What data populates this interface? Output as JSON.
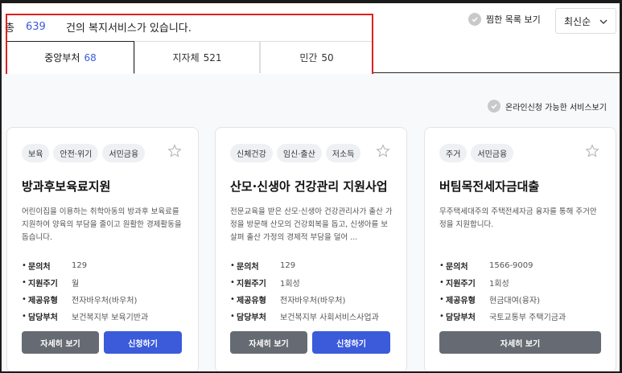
{
  "header": {
    "total_prefix": "총",
    "total_count": "639",
    "total_suffix": "건의 복지서비스가 있습니다.",
    "wishlist_label": "찜한 목록 보기",
    "sort_value": "최신순"
  },
  "tabs": [
    {
      "label": "중앙부처",
      "count": "68",
      "active": true
    },
    {
      "label": "지자체",
      "count": "521",
      "active": false
    },
    {
      "label": "민간",
      "count": "50",
      "active": false
    }
  ],
  "online_filter_label": "온라인신청 가능한 서비스보기",
  "cards": [
    {
      "tags": [
        "보육",
        "안전·위기",
        "서민금융"
      ],
      "title": "방과후보육료지원",
      "description": "어린이집을 이용하는 취학아동의 방과후 보육료를 지원하여 양육의 부담을 줄이고 원활한 경제활동을 돕습니다.",
      "info": [
        {
          "label": "문의처",
          "value": "129"
        },
        {
          "label": "지원주기",
          "value": "월"
        },
        {
          "label": "제공유형",
          "value": "전자바우처(바우처)"
        },
        {
          "label": "담당부처",
          "value": "보건복지부 보육기반과"
        }
      ],
      "detail_label": "자세히 보기",
      "apply_label": "신청하기"
    },
    {
      "tags": [
        "신체건강",
        "임신·출산",
        "저소득"
      ],
      "title": "산모·신생아 건강관리 지원사업",
      "description": "전문교육을 받은 산모·신생아 건강관리사가 출산 가정을 방문해 산모의 건강회복을 돕고, 신생아를 보살펴 출산 가정의 경제적 부담을 덜어 ...",
      "info": [
        {
          "label": "문의처",
          "value": "129"
        },
        {
          "label": "지원주기",
          "value": "1회성"
        },
        {
          "label": "제공유형",
          "value": "전자바우처(바우처)"
        },
        {
          "label": "담당부처",
          "value": "보건복지부 사회서비스사업과"
        }
      ],
      "detail_label": "자세히 보기",
      "apply_label": "신청하기"
    },
    {
      "tags": [
        "주거",
        "서민금융"
      ],
      "title": "버팀목전세자금대출",
      "description": "무주택세대주의 주택전세자금 융자를 통해 주거안정을 지원합니다.",
      "info": [
        {
          "label": "문의처",
          "value": "1566-9009"
        },
        {
          "label": "지원주기",
          "value": "1회성"
        },
        {
          "label": "제공유형",
          "value": "현금대여(융자)"
        },
        {
          "label": "담당부처",
          "value": "국토교통부 주택기금과"
        }
      ],
      "detail_label": "자세히 보기"
    }
  ],
  "colors": {
    "accent": "#3b5bdb",
    "highlight": "#e02020",
    "button_gray": "#666b73"
  }
}
